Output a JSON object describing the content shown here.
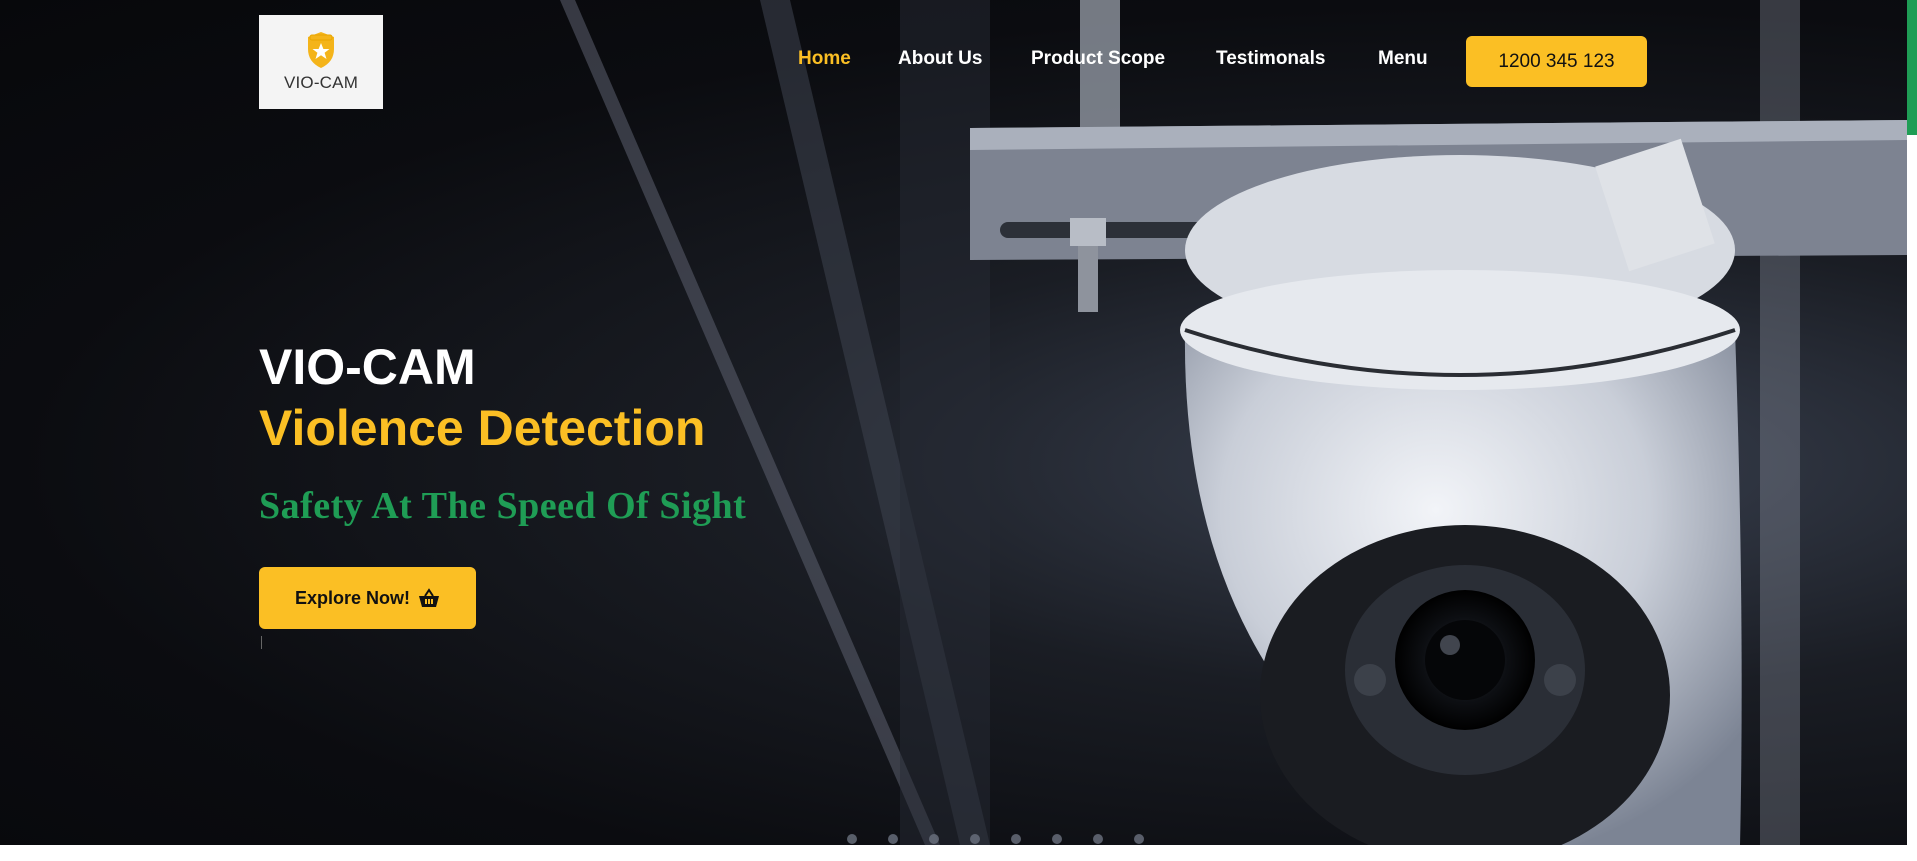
{
  "brand": {
    "logo_text": "VIO-CAM"
  },
  "nav": {
    "items": [
      {
        "label": "Home",
        "active": true
      },
      {
        "label": "About Us",
        "active": false
      },
      {
        "label": "Product Scope",
        "active": false
      },
      {
        "label": "Testimonals",
        "active": false
      },
      {
        "label": "Menu",
        "active": false
      }
    ],
    "phone": "1200 345 123"
  },
  "hero": {
    "title": "VIO-CAM",
    "subtitle": "Violence Detection",
    "tagline": "Safety At The Speed Of Sight",
    "cta_label": "Explore Now!",
    "cta_icon": "basket-icon",
    "slide_count": 8
  },
  "colors": {
    "accent": "#fbbf24",
    "tagline": "#1f9d55",
    "nav_text": "#ffffff"
  }
}
